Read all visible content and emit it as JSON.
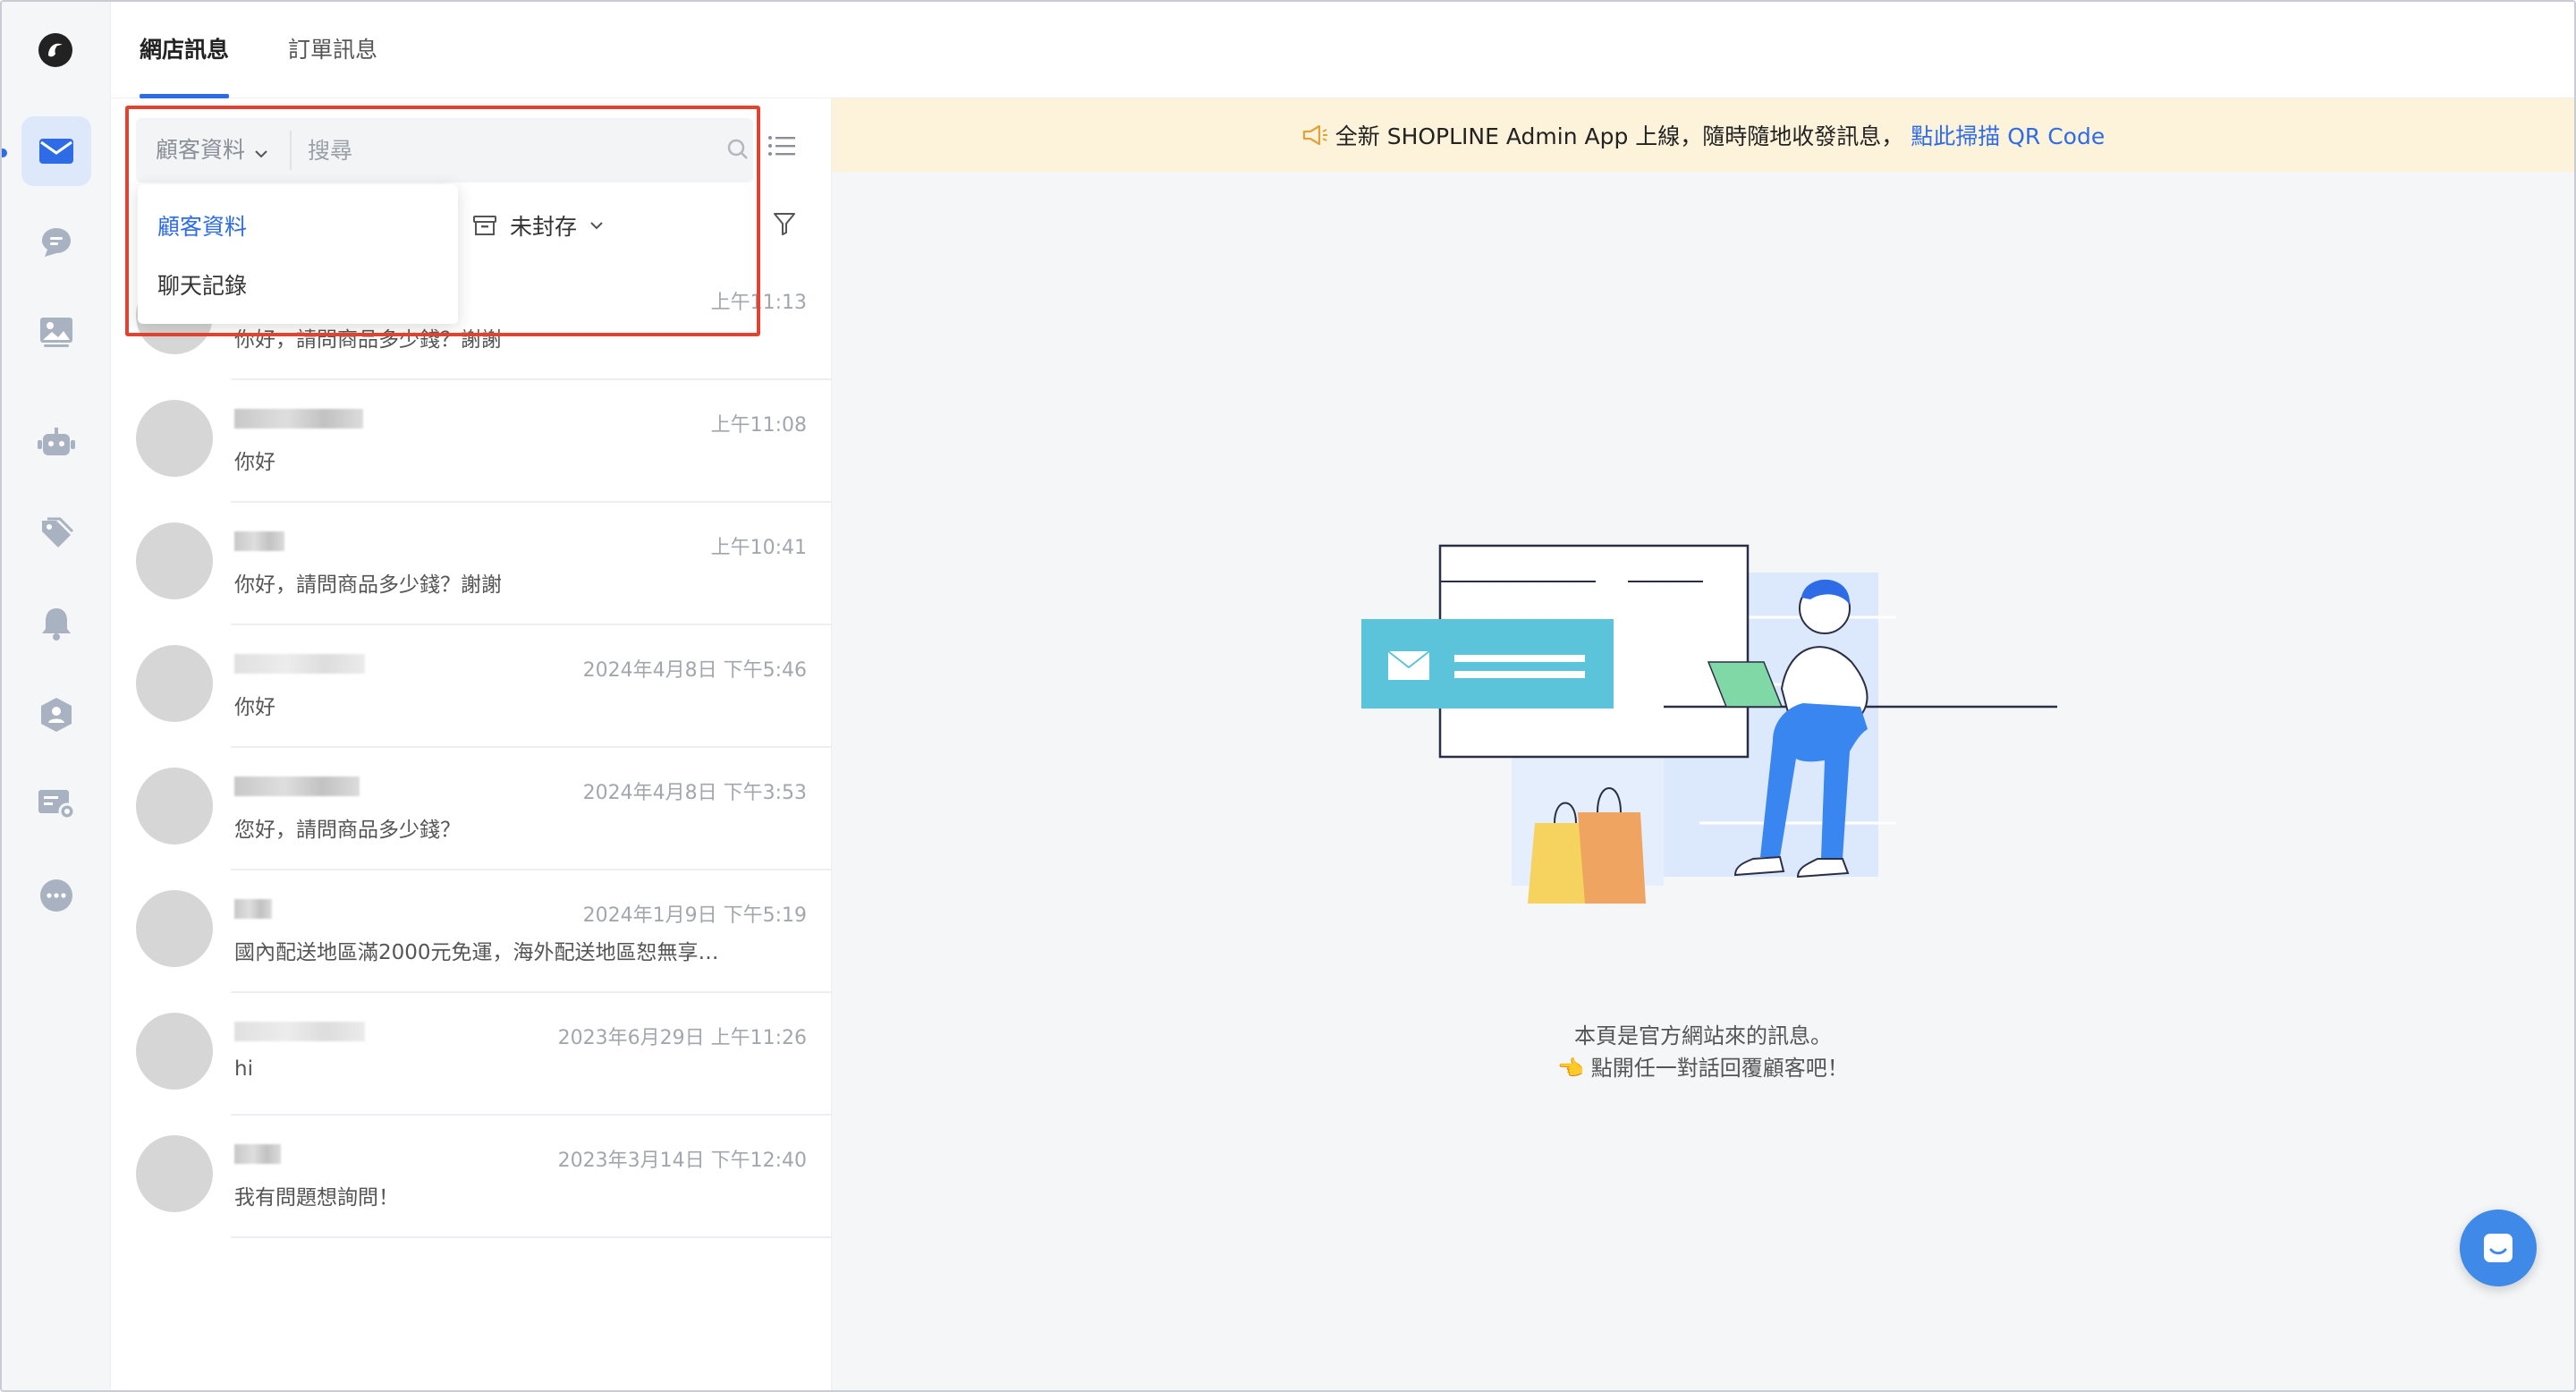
{
  "tabs": [
    {
      "label": "網店訊息",
      "active": true
    },
    {
      "label": "訂單訊息",
      "active": false
    }
  ],
  "rail": {
    "items": [
      {
        "icon": "mail-icon",
        "active": true
      },
      {
        "icon": "chat-bubble-icon"
      },
      {
        "icon": "image-icon"
      },
      {
        "icon": "robot-icon"
      },
      {
        "icon": "tag-icon"
      },
      {
        "icon": "bell-icon"
      },
      {
        "icon": "customer-hexagon-icon"
      },
      {
        "icon": "message-settings-icon"
      },
      {
        "icon": "more-icon"
      }
    ]
  },
  "search": {
    "type_label": "顧客資料",
    "placeholder": "搜尋",
    "value": ""
  },
  "dropdown": {
    "options": [
      {
        "label": "顧客資料",
        "selected": true
      },
      {
        "label": "聊天記錄",
        "selected": false
      }
    ]
  },
  "filter": {
    "archive_label": "未封存"
  },
  "conversations": [
    {
      "time": "上午11:13",
      "message": "你好，請問商品多少錢？謝謝"
    },
    {
      "time": "上午11:08",
      "message": "你好"
    },
    {
      "time": "上午10:41",
      "message": "你好，請問商品多少錢？謝謝"
    },
    {
      "time": "2024年4月8日 下午5:46",
      "message": "你好"
    },
    {
      "time": "2024年4月8日 下午3:53",
      "message": "您好，請問商品多少錢？"
    },
    {
      "time": "2024年1月9日 下午5:19",
      "message": "國內配送地區滿2000元免運，海外配送地區恕無享…"
    },
    {
      "time": "2023年6月29日 上午11:26",
      "message": "hi"
    },
    {
      "time": "2023年3月14日 下午12:40",
      "message": "我有問題想詢問！"
    }
  ],
  "banner": {
    "text": "全新 SHOPLINE Admin App 上線，隨時隨地收發訊息，",
    "link": "點此掃描 QR Code"
  },
  "empty_state": {
    "line1": "本頁是官方網站來的訊息。",
    "line2": "👈 點開任一對話回覆顧客吧！"
  },
  "colors": {
    "accent": "#2e6be6",
    "banner_bg": "#fdf3db",
    "highlight": "#e0432f"
  }
}
